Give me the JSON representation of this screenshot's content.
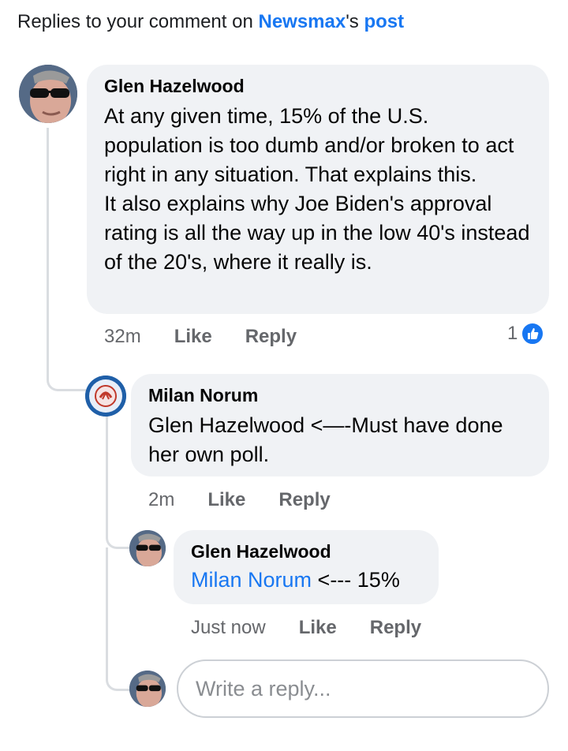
{
  "header": {
    "prefix": "Replies to your comment on ",
    "page_name": "Newsmax",
    "possessive": "'s ",
    "post_link": "post"
  },
  "comments": [
    {
      "author": "Glen Hazelwood",
      "text": "At any given time, 15% of the U.S. population is too dumb and/or broken to act right in any situation. That explains this.\nIt also explains why Joe Biden's approval rating is all the way up in the low 40's instead of the 20's, where it really is.",
      "time": "32m",
      "like_label": "Like",
      "reply_label": "Reply",
      "reaction_count": "1"
    },
    {
      "author": "Milan Norum",
      "text": "Glen Hazelwood <—-Must have done her own poll.",
      "time": "2m",
      "like_label": "Like",
      "reply_label": "Reply"
    },
    {
      "author": "Glen Hazelwood",
      "mention": "Milan Norum",
      "text": " <--- 15%",
      "time": "Just now",
      "like_label": "Like",
      "reply_label": "Reply"
    }
  ],
  "reply_input": {
    "placeholder": "Write a reply..."
  },
  "colors": {
    "accent": "#1877f2",
    "bubble": "#f0f2f5",
    "muted": "#65676b"
  }
}
